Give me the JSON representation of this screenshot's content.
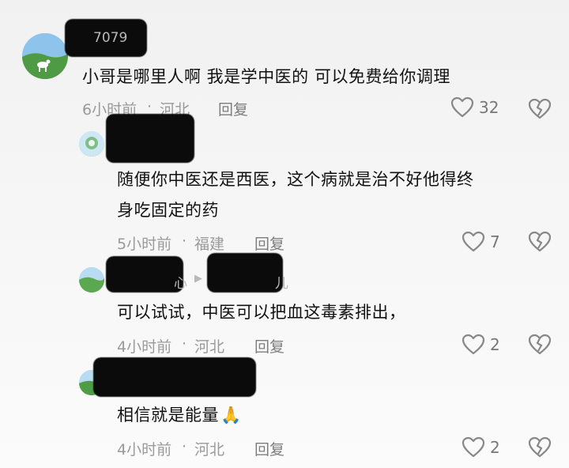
{
  "comments": [
    {
      "name_fragment": "7079",
      "text": "小哥是哪里人啊 我是学中医的 可以免费给你调理",
      "time": "6小时前",
      "location": "河北",
      "reply_label": "回复",
      "likes": "32"
    },
    {
      "text_line1": "随便你中医还是西医，这个病就是治不好他得终",
      "text_line2": "身吃固定的药",
      "time": "5小时前",
      "location": "福建",
      "reply_label": "回复",
      "likes": "7"
    },
    {
      "name_fragment_a": "心",
      "name_fragment_b": "儿",
      "text": "可以试试，中医可以把血这毒素排出，",
      "time": "4小时前",
      "location": "河北",
      "reply_label": "回复",
      "likes": "2"
    },
    {
      "text": "相信就是能量",
      "emoji": "🙏",
      "time": "4小时前",
      "location": "河北",
      "reply_label": "回复",
      "likes": "2"
    }
  ],
  "separator": "·",
  "icons": {
    "like": "heart-icon",
    "dislike": "broken-heart-icon",
    "avatar_art": "landscape-avatar"
  },
  "colors": {
    "text": "#111111",
    "meta": "#9a9a9a",
    "icon": "#888888"
  }
}
